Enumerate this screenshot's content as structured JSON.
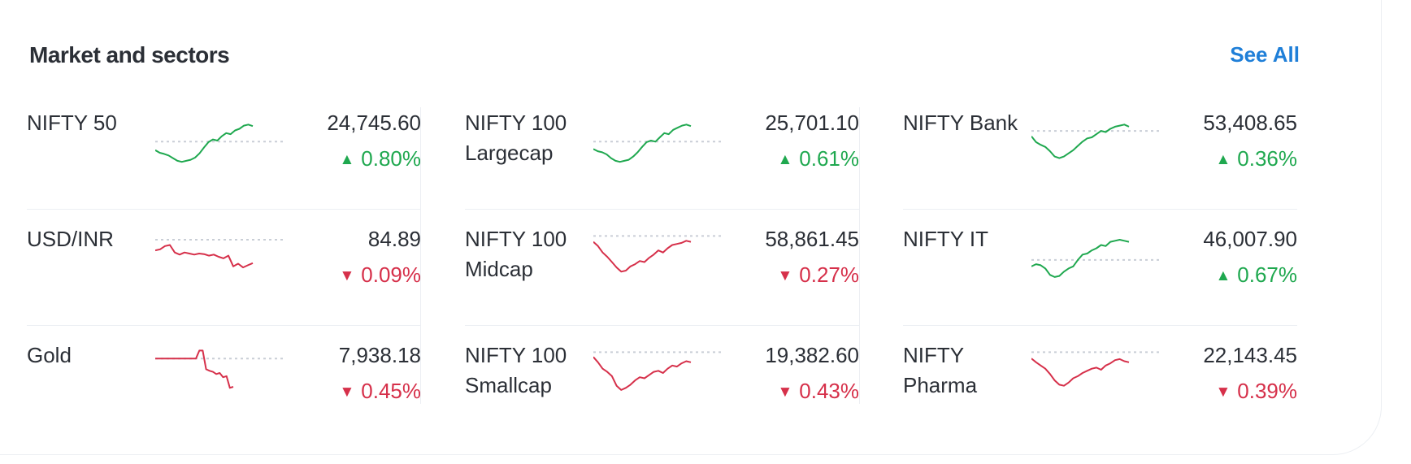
{
  "header": {
    "title": "Market and sectors",
    "see_all": "See All"
  },
  "colors": {
    "up": "#1fa84f",
    "down": "#d6304a",
    "link": "#1f7fd8",
    "baseline": "#c9ced6"
  },
  "columns": [
    {
      "items": [
        {
          "name": "NIFTY 50",
          "value": "24,745.60",
          "change": "0.80%",
          "direction": "up",
          "trend_icon": "triangle-up-icon",
          "spark": [
            0.4,
            0.35,
            0.33,
            0.3,
            0.25,
            0.2,
            0.18,
            0.2,
            0.22,
            0.26,
            0.34,
            0.45,
            0.55,
            0.6,
            0.58,
            0.66,
            0.72,
            0.7,
            0.77,
            0.8,
            0.86,
            0.88,
            0.85
          ],
          "baseline": 0.56
        },
        {
          "name": "USD/INR",
          "value": "84.89",
          "change": "0.09%",
          "direction": "down",
          "trend_icon": "triangle-down-icon",
          "spark": [
            0.7,
            0.72,
            0.78,
            0.8,
            0.66,
            0.62,
            0.66,
            0.64,
            0.62,
            0.64,
            0.63,
            0.6,
            0.62,
            0.58,
            0.55,
            0.6,
            0.4,
            0.45,
            0.38,
            0.42,
            0.46
          ],
          "baseline": 0.9
        },
        {
          "name": "Gold",
          "value": "7,938.18",
          "change": "0.45%",
          "direction": "down",
          "trend_icon": "triangle-down-icon",
          "spark": [
            0.85,
            0.85,
            0.85,
            0.85,
            0.85,
            0.85,
            0.85,
            0.85,
            0.85,
            0.85,
            0.85,
            0.85,
            0.85,
            1.0,
            1.0,
            0.65,
            0.62,
            0.6,
            0.56,
            0.58,
            0.5,
            0.52,
            0.3,
            0.32
          ],
          "baseline": 0.85,
          "partial": 0.6
        }
      ]
    },
    {
      "items": [
        {
          "name": "NIFTY 100 Largecap",
          "value": "25,701.10",
          "change": "0.61%",
          "direction": "up",
          "trend_icon": "triangle-up-icon",
          "spark": [
            0.42,
            0.38,
            0.36,
            0.32,
            0.25,
            0.2,
            0.18,
            0.2,
            0.22,
            0.28,
            0.36,
            0.46,
            0.55,
            0.58,
            0.56,
            0.64,
            0.72,
            0.7,
            0.78,
            0.82,
            0.86,
            0.88,
            0.85
          ],
          "baseline": 0.56
        },
        {
          "name": "NIFTY 100 Midcap",
          "value": "58,861.45",
          "change": "0.27%",
          "direction": "down",
          "trend_icon": "triangle-down-icon",
          "spark": [
            0.86,
            0.78,
            0.66,
            0.58,
            0.48,
            0.38,
            0.3,
            0.32,
            0.4,
            0.44,
            0.5,
            0.48,
            0.56,
            0.62,
            0.7,
            0.66,
            0.74,
            0.8,
            0.82,
            0.84,
            0.88,
            0.86
          ],
          "baseline": 0.97
        },
        {
          "name": "NIFTY 100 Smallcap",
          "value": "19,382.60",
          "change": "0.43%",
          "direction": "down",
          "trend_icon": "triangle-down-icon",
          "spark": [
            0.88,
            0.78,
            0.66,
            0.6,
            0.52,
            0.34,
            0.26,
            0.3,
            0.36,
            0.44,
            0.5,
            0.48,
            0.54,
            0.6,
            0.62,
            0.58,
            0.66,
            0.72,
            0.7,
            0.76,
            0.8,
            0.78
          ],
          "baseline": 0.97
        }
      ]
    },
    {
      "items": [
        {
          "name": "NIFTY Bank",
          "value": "53,408.65",
          "change": "0.36%",
          "direction": "up",
          "trend_icon": "triangle-up-icon",
          "spark": [
            0.66,
            0.55,
            0.5,
            0.46,
            0.38,
            0.28,
            0.25,
            0.28,
            0.34,
            0.4,
            0.48,
            0.56,
            0.62,
            0.64,
            0.7,
            0.76,
            0.74,
            0.8,
            0.84,
            0.86,
            0.88,
            0.84
          ],
          "baseline": 0.76
        },
        {
          "name": "NIFTY IT",
          "value": "46,007.90",
          "change": "0.67%",
          "direction": "up",
          "trend_icon": "triangle-up-icon",
          "spark": [
            0.4,
            0.44,
            0.42,
            0.36,
            0.24,
            0.2,
            0.22,
            0.3,
            0.36,
            0.4,
            0.52,
            0.62,
            0.64,
            0.7,
            0.74,
            0.8,
            0.78,
            0.86,
            0.88,
            0.9,
            0.88,
            0.86
          ],
          "baseline": 0.52
        },
        {
          "name": "NIFTY Pharma",
          "value": "22,143.45",
          "change": "0.39%",
          "direction": "down",
          "trend_icon": "triangle-down-icon",
          "spark": [
            0.85,
            0.78,
            0.72,
            0.66,
            0.56,
            0.44,
            0.36,
            0.34,
            0.4,
            0.48,
            0.52,
            0.58,
            0.62,
            0.66,
            0.68,
            0.64,
            0.72,
            0.76,
            0.82,
            0.84,
            0.8,
            0.78
          ],
          "baseline": 0.97
        }
      ]
    }
  ]
}
